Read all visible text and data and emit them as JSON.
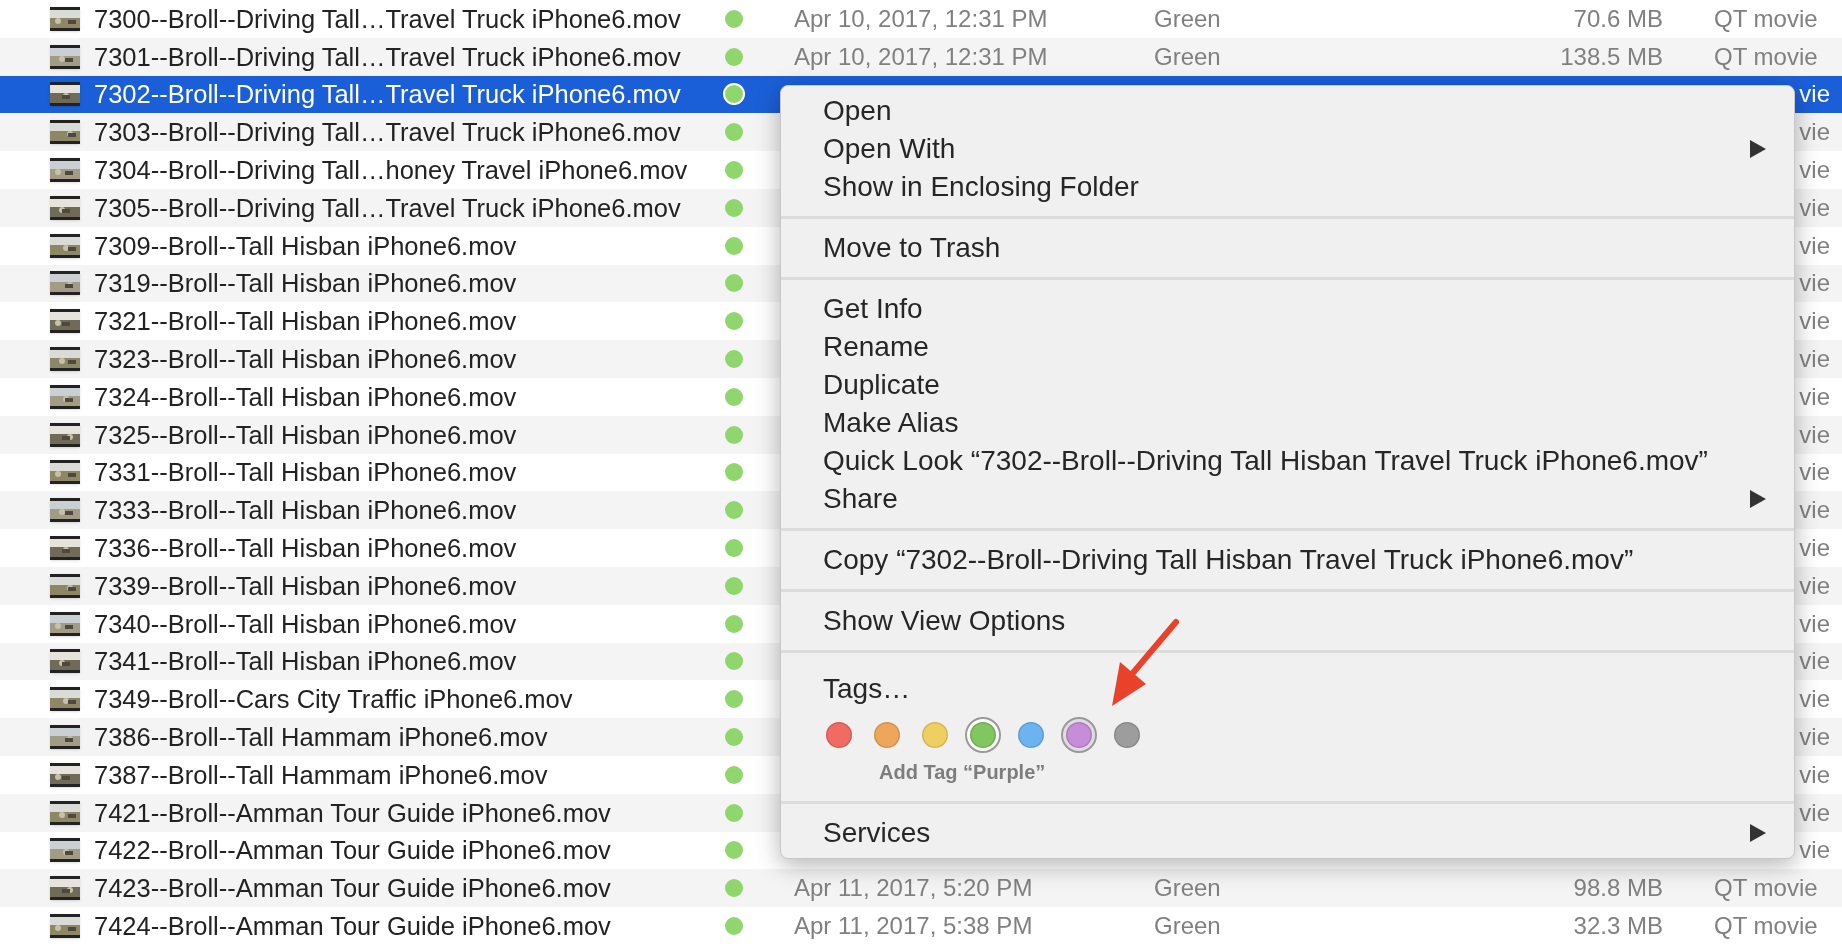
{
  "files": [
    {
      "name": "7300--Broll--Driving Tall…Travel Truck iPhone6.mov",
      "color": "#8fd66d",
      "date": "Apr 10, 2017, 12:31 PM",
      "color_label": "Green",
      "size": "70.6 MB",
      "kind": "QT movie",
      "selected": false
    },
    {
      "name": "7301--Broll--Driving Tall…Travel Truck iPhone6.mov",
      "color": "#8fd66d",
      "date": "Apr 10, 2017, 12:31 PM",
      "color_label": "Green",
      "size": "138.5 MB",
      "kind": "QT movie",
      "selected": false
    },
    {
      "name": "7302--Broll--Driving Tall…Travel Truck iPhone6.mov",
      "color": "#8fd66d",
      "kind": "vie",
      "selected": true
    },
    {
      "name": "7303--Broll--Driving Tall…Travel Truck iPhone6.mov",
      "color": "#8fd66d",
      "kind": "vie",
      "selected": false
    },
    {
      "name": "7304--Broll--Driving Tall…honey Travel iPhone6.mov",
      "color": "#8fd66d",
      "kind": "vie",
      "selected": false
    },
    {
      "name": "7305--Broll--Driving Tall…Travel Truck iPhone6.mov",
      "color": "#8fd66d",
      "kind": "vie",
      "selected": false
    },
    {
      "name": "7309--Broll--Tall Hisban iPhone6.mov",
      "color": "#8fd66d",
      "kind": "vie",
      "selected": false
    },
    {
      "name": "7319--Broll--Tall Hisban iPhone6.mov",
      "color": "#8fd66d",
      "kind": "vie",
      "selected": false
    },
    {
      "name": "7321--Broll--Tall Hisban iPhone6.mov",
      "color": "#8fd66d",
      "kind": "vie",
      "selected": false
    },
    {
      "name": "7323--Broll--Tall Hisban iPhone6.mov",
      "color": "#8fd66d",
      "kind": "vie",
      "selected": false
    },
    {
      "name": "7324--Broll--Tall Hisban iPhone6.mov",
      "color": "#8fd66d",
      "kind": "vie",
      "selected": false
    },
    {
      "name": "7325--Broll--Tall Hisban iPhone6.mov",
      "color": "#8fd66d",
      "kind": "vie",
      "selected": false
    },
    {
      "name": "7331--Broll--Tall Hisban iPhone6.mov",
      "color": "#8fd66d",
      "kind": "vie",
      "selected": false
    },
    {
      "name": "7333--Broll--Tall Hisban iPhone6.mov",
      "color": "#8fd66d",
      "kind": "vie",
      "selected": false
    },
    {
      "name": "7336--Broll--Tall Hisban iPhone6.mov",
      "color": "#8fd66d",
      "kind": "vie",
      "selected": false
    },
    {
      "name": "7339--Broll--Tall Hisban iPhone6.mov",
      "color": "#8fd66d",
      "kind": "vie",
      "selected": false
    },
    {
      "name": "7340--Broll--Tall Hisban iPhone6.mov",
      "color": "#8fd66d",
      "kind": "vie",
      "selected": false
    },
    {
      "name": "7341--Broll--Tall Hisban iPhone6.mov",
      "color": "#8fd66d",
      "kind": "vie",
      "selected": false
    },
    {
      "name": "7349--Broll--Cars City Traffic iPhone6.mov",
      "color": "#8fd66d",
      "kind": "vie",
      "selected": false
    },
    {
      "name": "7386--Broll--Tall Hammam iPhone6.mov",
      "color": "#8fd66d",
      "kind": "vie",
      "selected": false
    },
    {
      "name": "7387--Broll--Tall Hammam iPhone6.mov",
      "color": "#8fd66d",
      "kind": "vie",
      "selected": false
    },
    {
      "name": "7421--Broll--Amman Tour Guide iPhone6.mov",
      "color": "#8fd66d",
      "kind": "vie",
      "selected": false
    },
    {
      "name": "7422--Broll--Amman Tour Guide iPhone6.mov",
      "color": "#8fd66d",
      "kind": "vie",
      "selected": false
    },
    {
      "name": "7423--Broll--Amman Tour Guide iPhone6.mov",
      "color": "#8fd66d",
      "date": "Apr 11, 2017, 5:20 PM",
      "color_label": "Green",
      "size": "98.8 MB",
      "kind": "QT movie",
      "selected": false
    },
    {
      "name": "7424--Broll--Amman Tour Guide iPhone6.mov",
      "color": "#8fd66d",
      "date": "Apr 11, 2017, 5:38 PM",
      "color_label": "Green",
      "size": "32.3 MB",
      "kind": "QT movie",
      "selected": false
    }
  ],
  "context_menu": {
    "groups": [
      {
        "items": [
          {
            "label": "Open",
            "submenu": false
          },
          {
            "label": "Open With",
            "submenu": true
          },
          {
            "label": "Show in Enclosing Folder",
            "submenu": false
          }
        ]
      },
      {
        "items": [
          {
            "label": "Move to Trash",
            "submenu": false
          }
        ]
      },
      {
        "items": [
          {
            "label": "Get Info",
            "submenu": false
          },
          {
            "label": "Rename",
            "submenu": false
          },
          {
            "label": "Duplicate",
            "submenu": false
          },
          {
            "label": "Make Alias",
            "submenu": false
          },
          {
            "label": "Quick Look “7302--Broll--Driving Tall Hisban Travel Truck iPhone6.mov”",
            "submenu": false
          },
          {
            "label": "Share",
            "submenu": true
          }
        ]
      },
      {
        "items": [
          {
            "label": "Copy “7302--Broll--Driving Tall Hisban Travel Truck iPhone6.mov”",
            "submenu": false
          }
        ]
      },
      {
        "items": [
          {
            "label": "Show View Options",
            "submenu": false
          }
        ]
      },
      {
        "kind": "tags",
        "label": "Tags…",
        "tags": [
          {
            "color": "#ef6b63",
            "selected": false,
            "hovered": false
          },
          {
            "color": "#eea75a",
            "selected": false,
            "hovered": false
          },
          {
            "color": "#f0cf62",
            "selected": false,
            "hovered": false
          },
          {
            "color": "#82c65f",
            "selected": true,
            "hovered": false
          },
          {
            "color": "#6cb3f1",
            "selected": false,
            "hovered": false
          },
          {
            "color": "#c78dda",
            "selected": false,
            "hovered": true
          },
          {
            "color": "#9d9d9d",
            "selected": false,
            "hovered": false
          }
        ],
        "hint": "Add Tag “Purple”"
      },
      {
        "items": [
          {
            "label": "Services",
            "submenu": true
          }
        ]
      }
    ]
  },
  "annotation": {
    "kind": "arrow",
    "color": "#e8432a"
  }
}
